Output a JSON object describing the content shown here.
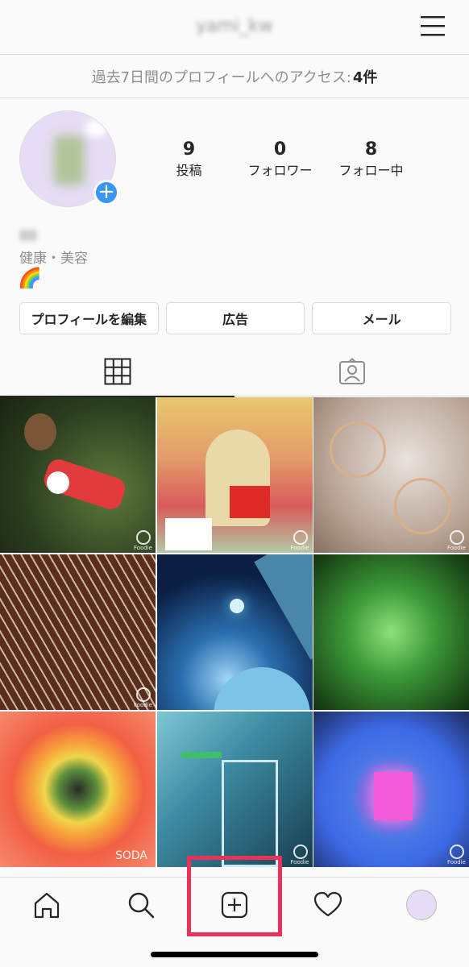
{
  "header": {
    "username": "yami_kw",
    "menu_icon": "hamburger-menu-icon"
  },
  "insights": {
    "text": "過去7日間のプロフィールへのアクセス: ",
    "count": "4件"
  },
  "profile": {
    "stats": [
      {
        "value": "9",
        "label": "投稿"
      },
      {
        "value": "0",
        "label": "フォロワー"
      },
      {
        "value": "8",
        "label": "フォロー中"
      }
    ],
    "category": "健康・美容",
    "emoji": "🌈"
  },
  "buttons": {
    "edit": "プロフィールを編集",
    "ads": "広告",
    "email": "メール"
  },
  "grid_watermarks": [
    "Foodie",
    "Foodie",
    "Foodie",
    "Foodie",
    "",
    "",
    "SODA",
    "Foodie",
    "Foodie"
  ],
  "colors": {
    "accent": "#3897f0",
    "highlight": "#e8325a"
  }
}
